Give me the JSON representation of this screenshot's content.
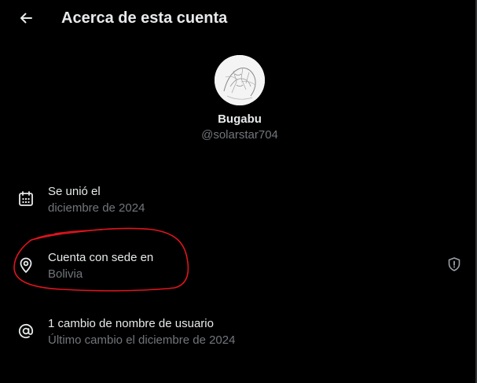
{
  "header": {
    "title": "Acerca de esta cuenta",
    "back_icon": "arrow-left-icon"
  },
  "profile": {
    "avatar_icon": "sketch-avatar",
    "display_name": "Bugabu",
    "handle": "@solarstar704"
  },
  "rows": [
    {
      "icon": "calendar-icon",
      "label": "Se unió el",
      "value": "diciembre de 2024"
    },
    {
      "icon": "location-pin-icon",
      "label": "Cuenta con sede en",
      "value": "Bolivia",
      "trailing_icon": "shield-exclamation-icon"
    },
    {
      "icon": "at-sign-icon",
      "label": "1 cambio de nombre de usuario",
      "value": "Último cambio el diciembre de 2024"
    }
  ],
  "colors": {
    "background": "#000000",
    "primary_text": "#e7e9ea",
    "secondary_text": "#71767b",
    "annotation": "#e0141e"
  }
}
